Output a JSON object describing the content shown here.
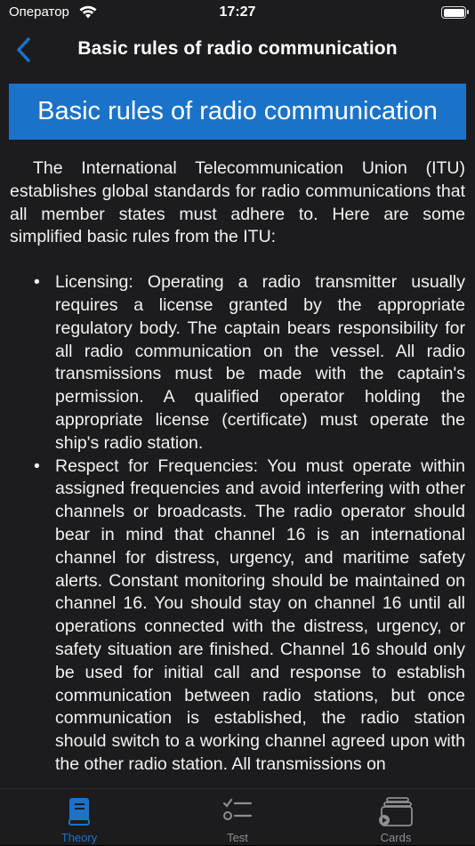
{
  "status_bar": {
    "carrier": "Оператор",
    "time": "17:27"
  },
  "nav": {
    "title": "Basic rules of radio communication",
    "back_icon": "chevron-left-icon"
  },
  "article": {
    "header": "Basic rules of radio communication",
    "intro": "The International Telecommunication Union (ITU) establishes global standards for radio communications that all member states must adhere to. Here are some simplified basic rules from the ITU:",
    "bullets": [
      "Licensing: Operating a radio transmitter usually requires a license granted by the appropriate regulatory body. The captain bears responsibility for all radio communication on the vessel. All radio transmissions must be made with the captain's permission. A qualified operator holding the appropriate license (certificate) must operate the ship's radio station.",
      "Respect for Frequencies: You must operate within assigned frequencies and avoid interfering with other channels or broadcasts. The radio operator should bear in mind that channel 16 is an international channel for distress, urgency, and maritime safety alerts. Constant monitoring should be maintained on channel 16. You should stay on channel 16 until all operations connected with the distress, urgency, or safety situation are finished. Channel 16 should only be used for initial call and response to establish communication between radio stations, but once communication is established, the radio station should switch to a working channel agreed upon with the other radio station. All transmissions on"
    ],
    "bullet_char": "•"
  },
  "tabs": [
    {
      "label": "Theory",
      "icon": "book-icon",
      "active": true
    },
    {
      "label": "Test",
      "icon": "checklist-icon",
      "active": false
    },
    {
      "label": "Cards",
      "icon": "cards-stack-icon",
      "active": false
    }
  ],
  "colors": {
    "accent": "#1a73c8",
    "background": "#1c1c1e",
    "inactive": "#8e8e93"
  }
}
